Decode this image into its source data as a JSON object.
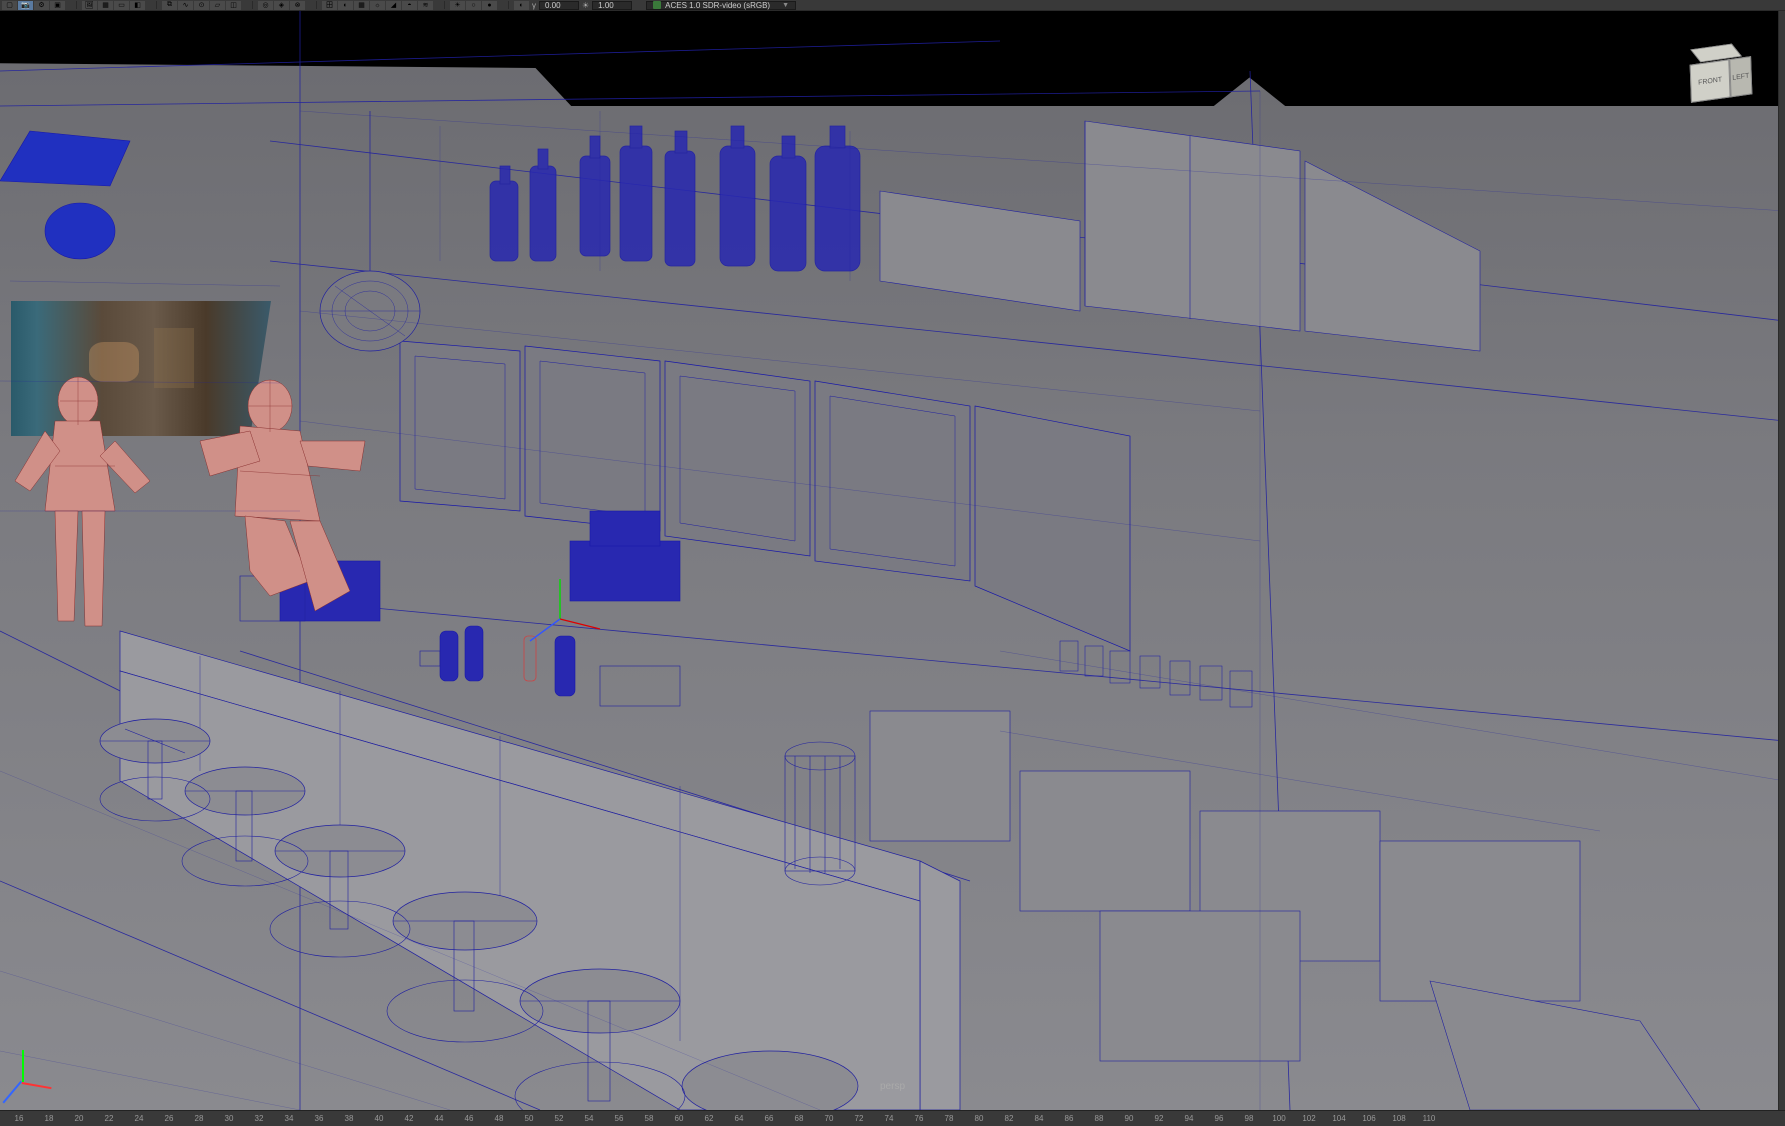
{
  "toolbar": {
    "gamma_label": "γ",
    "gamma_value": "0.00",
    "exposure_icon": "☀",
    "exposure_value": "1.00",
    "color_space": "ACES 1.0 SDR-video (sRGB)"
  },
  "viewport": {
    "camera_label": "persp",
    "viewcube": {
      "front": "FRONT",
      "left": "LEFT"
    }
  },
  "timeline": {
    "frames": [
      16,
      18,
      20,
      22,
      24,
      26,
      28,
      30,
      32,
      34,
      36,
      38,
      40,
      42,
      44,
      46,
      48,
      50,
      52,
      54,
      56,
      58,
      60,
      62,
      64,
      66,
      68,
      70,
      72,
      74,
      76,
      78,
      80,
      82,
      84,
      86,
      88,
      90,
      92,
      94,
      96,
      98,
      100,
      102,
      104,
      106,
      108,
      110
    ]
  },
  "icons": {
    "select": "▢",
    "lasso": "◌",
    "move": "✥",
    "rotate": "↻",
    "scale": "⤢",
    "camera": "📷",
    "magnet": "⧉",
    "grid": "▦",
    "shade": "◐",
    "light": "☼",
    "play": "▶",
    "key": "◆",
    "dropdown": "▼"
  }
}
